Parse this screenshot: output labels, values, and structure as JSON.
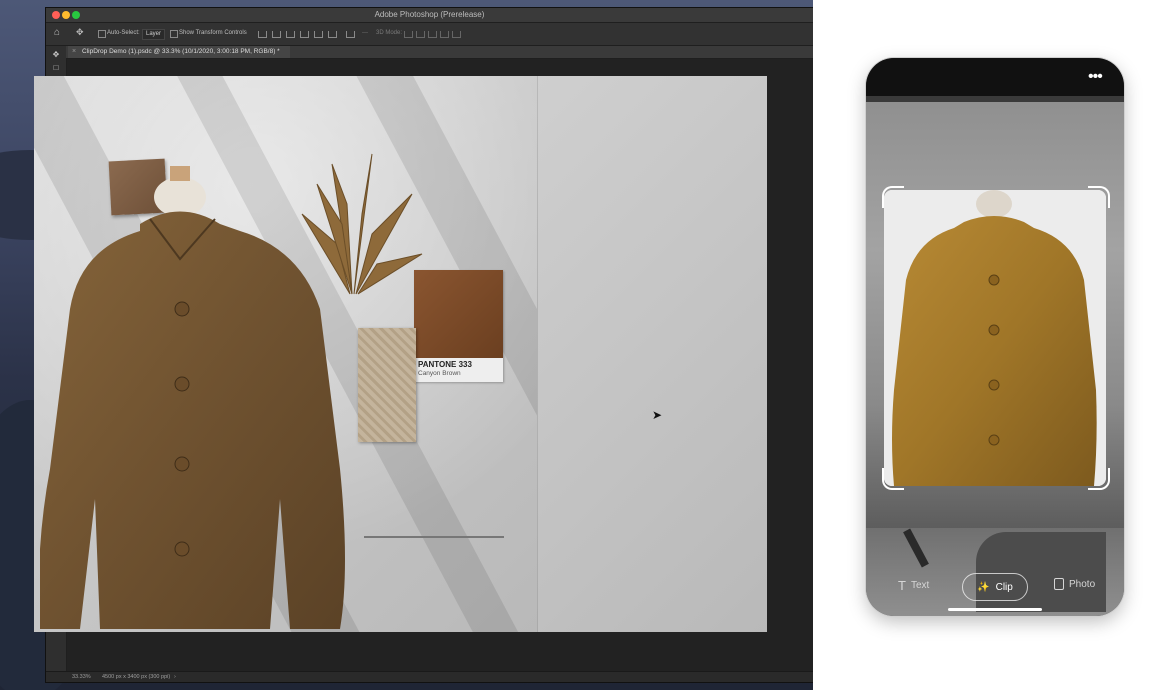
{
  "photoshop": {
    "window_title": "Adobe Photoshop (Prerelease)",
    "options": {
      "auto_select_label": "Auto-Select:",
      "auto_select_value": "Layer",
      "show_transform_label": "Show Transform Controls",
      "mode_3d_label": "3D Mode:"
    },
    "document_tab": "ClipDrop Demo (1).psdc @ 33.3% (10/1/2020, 3:00:18 PM, RGB/8) *",
    "status": {
      "zoom": "33.33%",
      "doc_info": "4500 px x 3400 px (300 ppi)"
    },
    "canvas": {
      "pantone_number": "PANTONE 333",
      "pantone_name": "Canyon Brown"
    }
  },
  "phone": {
    "modes": {
      "text": "Text",
      "clip": "Clip",
      "photo": "Photo"
    },
    "active_mode": "clip"
  },
  "colors": {
    "accent_brown": "#8a5530",
    "jacket": "#7a5a2e",
    "jacket_phone": "#a67c2c"
  }
}
